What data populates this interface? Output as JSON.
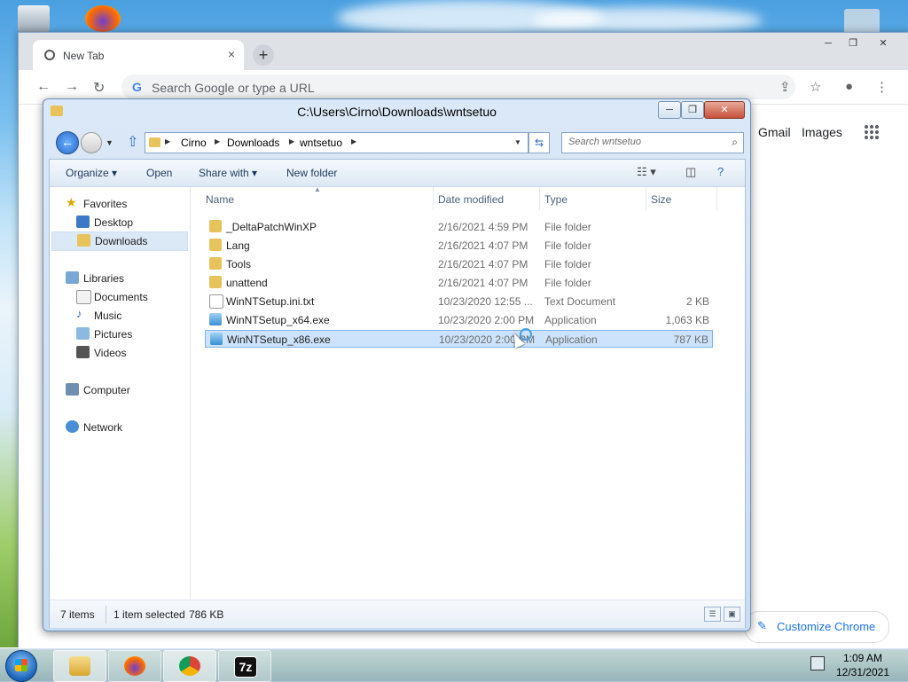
{
  "chrome": {
    "tab_title": "New Tab",
    "tab_close": "×",
    "new_tab": "+",
    "omnibox_placeholder": "Search Google or type a URL",
    "gmail": "Gmail",
    "images": "Images",
    "customize": "Customize Chrome",
    "window_controls": [
      "─",
      "❐",
      "✕"
    ]
  },
  "explorer": {
    "title": "C:\\Users\\Cirno\\Downloads\\wntsetuo",
    "breadcrumbs": [
      "Cirno",
      "Downloads",
      "wntsetuo"
    ],
    "search_placeholder": "Search wntsetuo",
    "commands": {
      "organize": "Organize ▾",
      "open": "Open",
      "share_with": "Share with ▾",
      "new_folder": "New folder"
    },
    "nav": {
      "favorites": "Favorites",
      "desktop": "Desktop",
      "downloads": "Downloads",
      "libraries": "Libraries",
      "documents": "Documents",
      "music": "Music",
      "pictures": "Pictures",
      "videos": "Videos",
      "computer": "Computer",
      "network": "Network"
    },
    "columns": {
      "name": "Name",
      "date": "Date modified",
      "type": "Type",
      "size": "Size"
    },
    "files": [
      {
        "name": "_DeltaPatchWinXP",
        "date": "2/16/2021 4:59 PM",
        "type": "File folder",
        "size": "",
        "icon": "folder-icon"
      },
      {
        "name": "Lang",
        "date": "2/16/2021 4:07 PM",
        "type": "File folder",
        "size": "",
        "icon": "folder-icon"
      },
      {
        "name": "Tools",
        "date": "2/16/2021 4:07 PM",
        "type": "File folder",
        "size": "",
        "icon": "folder-icon"
      },
      {
        "name": "unattend",
        "date": "2/16/2021 4:07 PM",
        "type": "File folder",
        "size": "",
        "icon": "folder-icon"
      },
      {
        "name": "WinNTSetup.ini.txt",
        "date": "10/23/2020 12:55 ...",
        "type": "Text Document",
        "size": "2 KB",
        "icon": "text-file-icon"
      },
      {
        "name": "WinNTSetup_x64.exe",
        "date": "10/23/2020 2:00 PM",
        "type": "Application",
        "size": "1,063 KB",
        "icon": "exe-icon"
      },
      {
        "name": "WinNTSetup_x86.exe",
        "date": "10/23/2020 2:00 PM",
        "type": "Application",
        "size": "787 KB",
        "icon": "exe-icon",
        "selected": true
      }
    ],
    "status": {
      "items": "7 items",
      "selected": "1 item selected",
      "size": "786 KB"
    }
  },
  "taskbar": {
    "apps": [
      "Windows Explorer",
      "Firefox",
      "Chrome",
      "7-Zip"
    ],
    "seven_zip_label": "7z",
    "time": "1:09 AM",
    "date": "12/31/2021"
  },
  "colors": {
    "accent": "#1a73e8",
    "selection": "#cce3fb",
    "folder": "#e8c25a"
  }
}
